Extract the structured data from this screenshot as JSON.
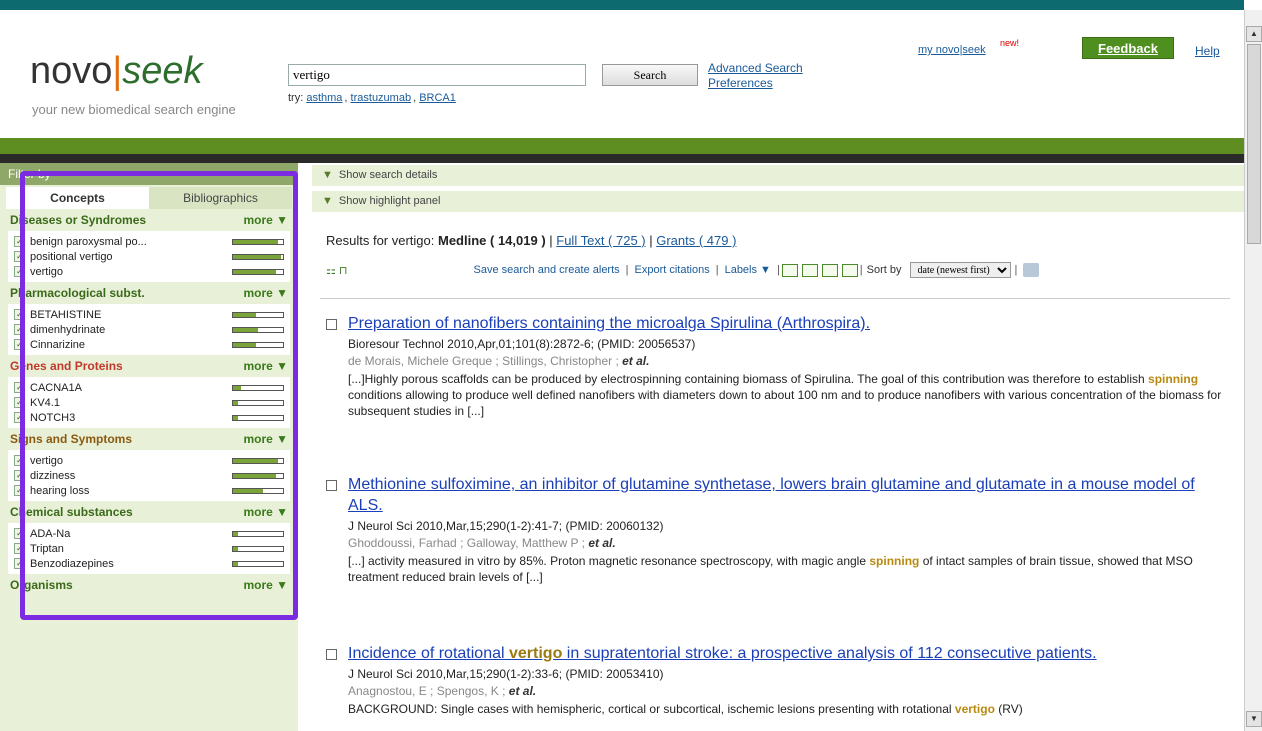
{
  "header": {
    "logo_novo": "novo",
    "logo_bar": "|",
    "logo_seek": "seek",
    "tagline": "your new biomedical search engine",
    "search_value": "vertigo",
    "search_button": "Search",
    "try_label": "try:",
    "try_links": [
      "asthma",
      "trastuzumab",
      "BRCA1"
    ],
    "advanced_search": "Advanced Search",
    "preferences": "Preferences",
    "my_novoseek": "my novo|seek",
    "new_tag": "new!",
    "feedback": "Feedback",
    "help": "Help"
  },
  "filter": {
    "title": "Filter by",
    "tabs": [
      "Concepts",
      "Bibliographics"
    ],
    "sections": [
      {
        "title": "Diseases or Syndromes",
        "color": "#3a6a1a",
        "more": "more ▼",
        "items": [
          {
            "label": "benign paroxysmal po...",
            "level": 0.9
          },
          {
            "label": "positional vertigo",
            "level": 0.95
          },
          {
            "label": "vertigo",
            "level": 0.85
          }
        ]
      },
      {
        "title": "Pharmacological subst.",
        "color": "#3a6a1a",
        "more": "more ▼",
        "items": [
          {
            "label": "BETAHISTINE",
            "level": 0.45
          },
          {
            "label": "dimenhydrinate",
            "level": 0.5
          },
          {
            "label": "Cinnarizine",
            "level": 0.45
          }
        ]
      },
      {
        "title": "Genes and Proteins",
        "color": "#c0392b",
        "more": "more ▼",
        "items": [
          {
            "label": "CACNA1A",
            "level": 0.15
          },
          {
            "label": "KV4.1",
            "level": 0.1
          },
          {
            "label": "NOTCH3",
            "level": 0.1
          }
        ]
      },
      {
        "title": "Signs and Symptoms",
        "color": "#8a5a10",
        "more": "more ▼",
        "items": [
          {
            "label": "vertigo",
            "level": 0.9
          },
          {
            "label": "dizziness",
            "level": 0.85
          },
          {
            "label": "hearing loss",
            "level": 0.6
          }
        ]
      },
      {
        "title": "Chemical substances",
        "color": "#3a6a1a",
        "more": "more ▼",
        "items": [
          {
            "label": "ADA-Na",
            "level": 0.1
          },
          {
            "label": "Triptan",
            "level": 0.1
          },
          {
            "label": "Benzodiazepines",
            "level": 0.1
          }
        ]
      },
      {
        "title": "Organisms",
        "color": "#3a6a1a",
        "more": "more ▼",
        "items": []
      }
    ]
  },
  "results": {
    "show_search_details": "Show search details",
    "show_highlight_panel": "Show highlight panel",
    "results_for": "Results for vertigo:",
    "medline": "Medline ( 14,019 )",
    "full_text": "Full Text ( 725 )",
    "grants": "Grants ( 479 )",
    "save_alerts": "Save search and create alerts",
    "export_citations": "Export citations",
    "labels": "Labels ▼",
    "sort_by": "Sort by",
    "sort_value": "date (newest first)",
    "items": [
      {
        "title": "Preparation of nanofibers containing the microalga Spirulina (Arthrospira).",
        "citation": "Bioresour Technol 2010,Apr,01;101(8):2872-6; (PMID: 20056537)",
        "authors": "de Morais, Michele Greque ; Stillings, Christopher ;",
        "etal": "et al.",
        "abstract_a": "[...]Highly porous scaffolds can be produced by electrospinning containing biomass of Spirulina. The goal of this contribution was therefore to establish ",
        "abstract_hl": "spinning",
        "abstract_b": " conditions allowing to produce well defined nanofibers with diameters down to about 100 nm and to produce nanofibers with various concentration of the biomass for subsequent studies in [...]"
      },
      {
        "title": "Methionine sulfoximine, an inhibitor of glutamine synthetase, lowers brain glutamine and glutamate in a mouse model of ALS.",
        "citation": "J Neurol Sci 2010,Mar,15;290(1-2):41-7; (PMID: 20060132)",
        "authors": "Ghoddoussi, Farhad ; Galloway, Matthew P ;",
        "etal": "et al.",
        "abstract_a": "[...] activity measured in vitro by 85%. Proton magnetic resonance spectroscopy, with magic angle ",
        "abstract_hl": "spinning",
        "abstract_b": " of intact samples of brain tissue, showed that MSO treatment reduced brain levels of [...]"
      },
      {
        "title_a": "Incidence of rotational ",
        "title_hl": "vertigo",
        "title_b": " in supratentorial stroke: a prospective analysis of 112 consecutive patients.",
        "citation": "J Neurol Sci 2010,Mar,15;290(1-2):33-6; (PMID: 20053410)",
        "authors": "Anagnostou, E ; Spengos, K ;",
        "etal": "et al.",
        "abstract_a": "BACKGROUND: Single cases with hemispheric, cortical or subcortical, ischemic lesions presenting with rotational ",
        "abstract_hl": "vertigo",
        "abstract_b": " (RV)"
      }
    ]
  }
}
